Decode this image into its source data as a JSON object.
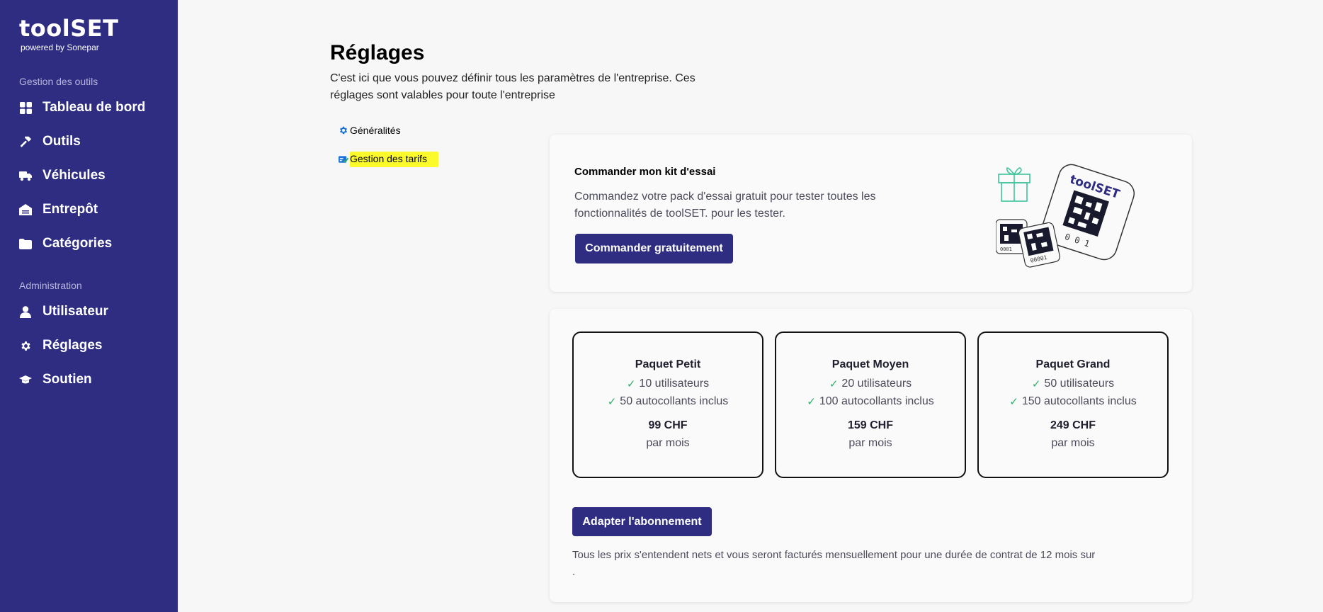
{
  "brand": {
    "name": "toolSET",
    "tagline": "powered by Sonepar",
    "accent": "#2e2d82",
    "highlight": "#fbfa2a"
  },
  "sidebar": {
    "section1": "Gestion des outils",
    "section2": "Administration",
    "items": [
      {
        "label": "Tableau de bord",
        "icon": "dashboard-grid-icon"
      },
      {
        "label": "Outils",
        "icon": "hammer-icon"
      },
      {
        "label": "Véhicules",
        "icon": "truck-icon"
      },
      {
        "label": "Entrepôt",
        "icon": "warehouse-icon"
      },
      {
        "label": "Catégories",
        "icon": "folder-icon"
      },
      {
        "label": "Utilisateur",
        "icon": "user-icon"
      },
      {
        "label": "Réglages",
        "icon": "gear-icon"
      },
      {
        "label": "Soutien",
        "icon": "graduation-cap-icon"
      }
    ]
  },
  "header": {
    "title": "Réglages",
    "description": "C'est ici que vous pouvez définir tous les paramètres de l'entreprise. Ces réglages sont valables pour toute l'entreprise"
  },
  "subnav": {
    "general": "Généralités",
    "pricing": "Gestion des tarifs"
  },
  "trial": {
    "title": "Commander mon kit d'essai",
    "text": "Commandez votre pack d'essai gratuit pour tester toutes les fonctionnalités de toolSET. pour les tester.",
    "button": "Commander gratuitement",
    "illustration_text": "toolSET",
    "sticker_number_1": "0001",
    "sticker_number_2": "00001",
    "sticker_number_3": "0 0 1"
  },
  "packages": [
    {
      "name": "Paquet Petit",
      "users": "10 utilisateurs",
      "stickers": "50 autocollants inclus",
      "price": "99 CHF",
      "period": "par mois"
    },
    {
      "name": "Paquet Moyen",
      "users": "20 utilisateurs",
      "stickers": "100 autocollants inclus",
      "price": "159 CHF",
      "period": "par mois"
    },
    {
      "name": "Paquet Grand",
      "users": "50 utilisateurs",
      "stickers": "150 autocollants inclus",
      "price": "249 CHF",
      "period": "par mois"
    }
  ],
  "subscription": {
    "button": "Adapter l'abonnement",
    "note": "Tous les prix s'entendent nets et vous seront facturés mensuellement pour une durée de contrat de 12 mois sur",
    "note_end": "."
  }
}
